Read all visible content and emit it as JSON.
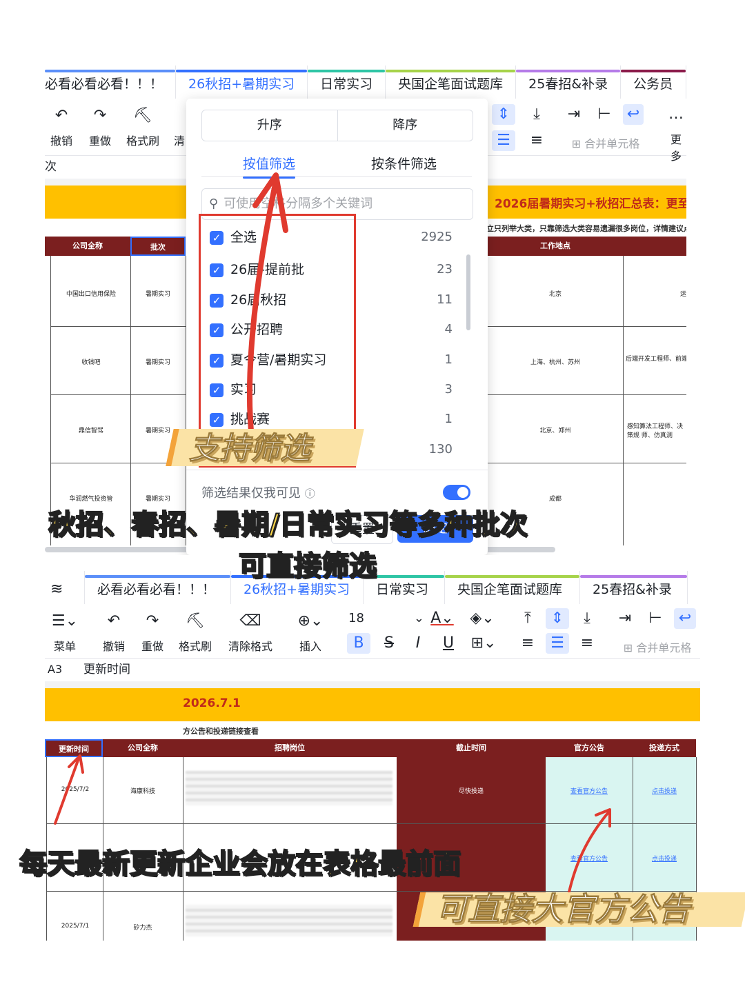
{
  "tabs": [
    {
      "label": "必看必看必看！！！",
      "color": "#5b8ff9"
    },
    {
      "label": "26秋招+暑期实习",
      "color": "#3370ff",
      "active": true
    },
    {
      "label": "日常实习",
      "color": "#2ec5a5"
    },
    {
      "label": "央国企笔面试题库",
      "color": "#a6d34a"
    },
    {
      "label": "25春招&补录",
      "color": "#b57be8"
    },
    {
      "label": "公务员",
      "color": "#8b1a4a"
    }
  ],
  "top_toolbar": {
    "undo": "撤销",
    "redo": "重做",
    "format_brush": "格式刷",
    "clear": "清",
    "merge": "合并单元格",
    "more": "更多"
  },
  "top_formula_text": "次",
  "top_banner": "2026届暑期实习+秋招汇总表：更至",
  "top_note": "立只列举大类，只靠筛选大类容易遗漏很多岗位，详情建议点击",
  "top_headers": {
    "company": "公司全称",
    "batch": "批次",
    "location": "工作地点"
  },
  "top_rows": [
    {
      "company": "中国出口信用保险",
      "batch": "暑期实习",
      "location": "北京",
      "extra": "运"
    },
    {
      "company": "收钱吧",
      "batch": "暑期实习",
      "location": "上海、杭州、苏州",
      "extra": "后端开发工程师、前端开"
    },
    {
      "company": "鼎信智驾",
      "batch": "暑期实习",
      "location": "北京、郑州",
      "extra": "感知算法工程师、决策规 师、仿真测"
    },
    {
      "company": "华润燃气投资管",
      "batch": "暑期实习",
      "location": "成都",
      "extra": ""
    }
  ],
  "popup": {
    "asc": "升序",
    "desc": "降序",
    "by_value": "按值筛选",
    "by_condition": "按条件筛选",
    "search_placeholder": "可使用空格分隔多个关键词",
    "options": [
      {
        "label": "全选",
        "count": "2925"
      },
      {
        "label": "26届-提前批",
        "count": "23"
      },
      {
        "label": "26届秋招",
        "count": "11"
      },
      {
        "label": "公开招聘",
        "count": "4"
      },
      {
        "label": "夏令营/暑期实习",
        "count": "1"
      },
      {
        "label": "实习",
        "count": "3"
      },
      {
        "label": "挑战赛",
        "count": "1"
      },
      {
        "label": "",
        "count": "130"
      }
    ],
    "visible_only": "筛选结果仅我可见",
    "reset": "重置",
    "confirm": "确定"
  },
  "bottom_tabs": [
    {
      "label": "必看必看必看！！！",
      "color": "#5b8ff9"
    },
    {
      "label": "26秋招+暑期实习",
      "color": "#3370ff",
      "active": true
    },
    {
      "label": "日常实习",
      "color": "#2ec5a5"
    },
    {
      "label": "央国企笔面试题库",
      "color": "#a6d34a"
    },
    {
      "label": "25春招&补录",
      "color": "#b57be8"
    }
  ],
  "bottom_toolbar": {
    "menu": "菜单",
    "undo": "撤销",
    "redo": "重做",
    "format_brush": "格式刷",
    "clear_format": "清除格式",
    "insert": "插入",
    "font_size": "18",
    "merge": "合并单元格"
  },
  "bottom_formula": {
    "cell": "A3",
    "value": "更新时间"
  },
  "bottom_banner": "2026.7.1",
  "bottom_note": "方公告和投递链接查看",
  "bottom_headers": {
    "update_time": "更新时间",
    "company": "公司全称",
    "positions": "招聘岗位",
    "deadline": "截止时间",
    "notice": "官方公告",
    "apply": "投递方式"
  },
  "bottom_rows": [
    {
      "date": "2025/7/2",
      "company": "海康科技",
      "deadline": "尽快投递",
      "notice": "查看官方公告",
      "apply": "点击投递"
    },
    {
      "date": "",
      "company": "",
      "deadline": "",
      "notice": "查看官方公告",
      "apply": "点击投递"
    },
    {
      "date": "2025/7/1",
      "company": "矽力杰",
      "deadline": "",
      "notice": "",
      "apply": ""
    }
  ],
  "captions": {
    "support_filter": "支持筛选",
    "line1": "秋招、春招、暑期/日常实习等多种批次",
    "line2": "可直接筛选",
    "line3": "每天最新更新企业会放在表格最前面",
    "official": "可直接大官方公告"
  },
  "colors": {
    "accent": "#3370ff",
    "banner": "#ffc000",
    "header_red": "#7b1f1f",
    "annotation_red": "#e03a2f",
    "caption_yellow": "#ffd94a"
  }
}
